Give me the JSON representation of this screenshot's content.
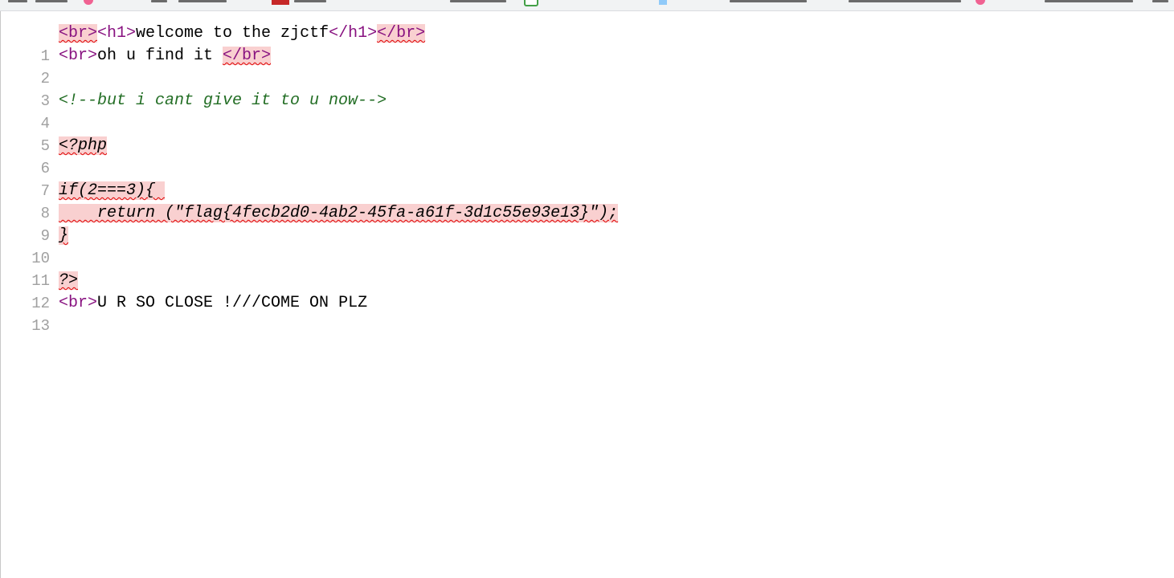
{
  "source_lines": [
    {
      "number": "1",
      "parts": [
        "<br>",
        "<h1>",
        "welcome to the zjctf",
        "</h1>",
        "</br>"
      ]
    },
    {
      "number": "2",
      "parts": [
        "<br>",
        "oh u find it ",
        "</br>"
      ]
    },
    {
      "number": "3",
      "parts": []
    },
    {
      "number": "4",
      "parts": [
        "<!--but i cant give it to u now-->"
      ]
    },
    {
      "number": "5",
      "parts": []
    },
    {
      "number": "6",
      "parts": [
        "<?php"
      ]
    },
    {
      "number": "7",
      "parts": []
    },
    {
      "number": "8",
      "parts": [
        "if(2===3){ "
      ]
    },
    {
      "number": "9",
      "parts": [
        "    return (\"flag{4fecb2d0-4ab2-45fa-a61f-3d1c55e93e13}\");"
      ]
    },
    {
      "number": "10",
      "parts": [
        "}"
      ]
    },
    {
      "number": "11",
      "parts": []
    },
    {
      "number": "12",
      "parts": [
        "?>"
      ]
    },
    {
      "number": "13",
      "parts": [
        "<br>",
        "U R SO CLOSE !///COME ON PLZ"
      ]
    }
  ],
  "colors": {
    "tag": "#881280",
    "comment": "#236e25",
    "error_background": "#f9d0d0",
    "error_underline": "#e00000",
    "line_number": "#a0a0a0"
  }
}
